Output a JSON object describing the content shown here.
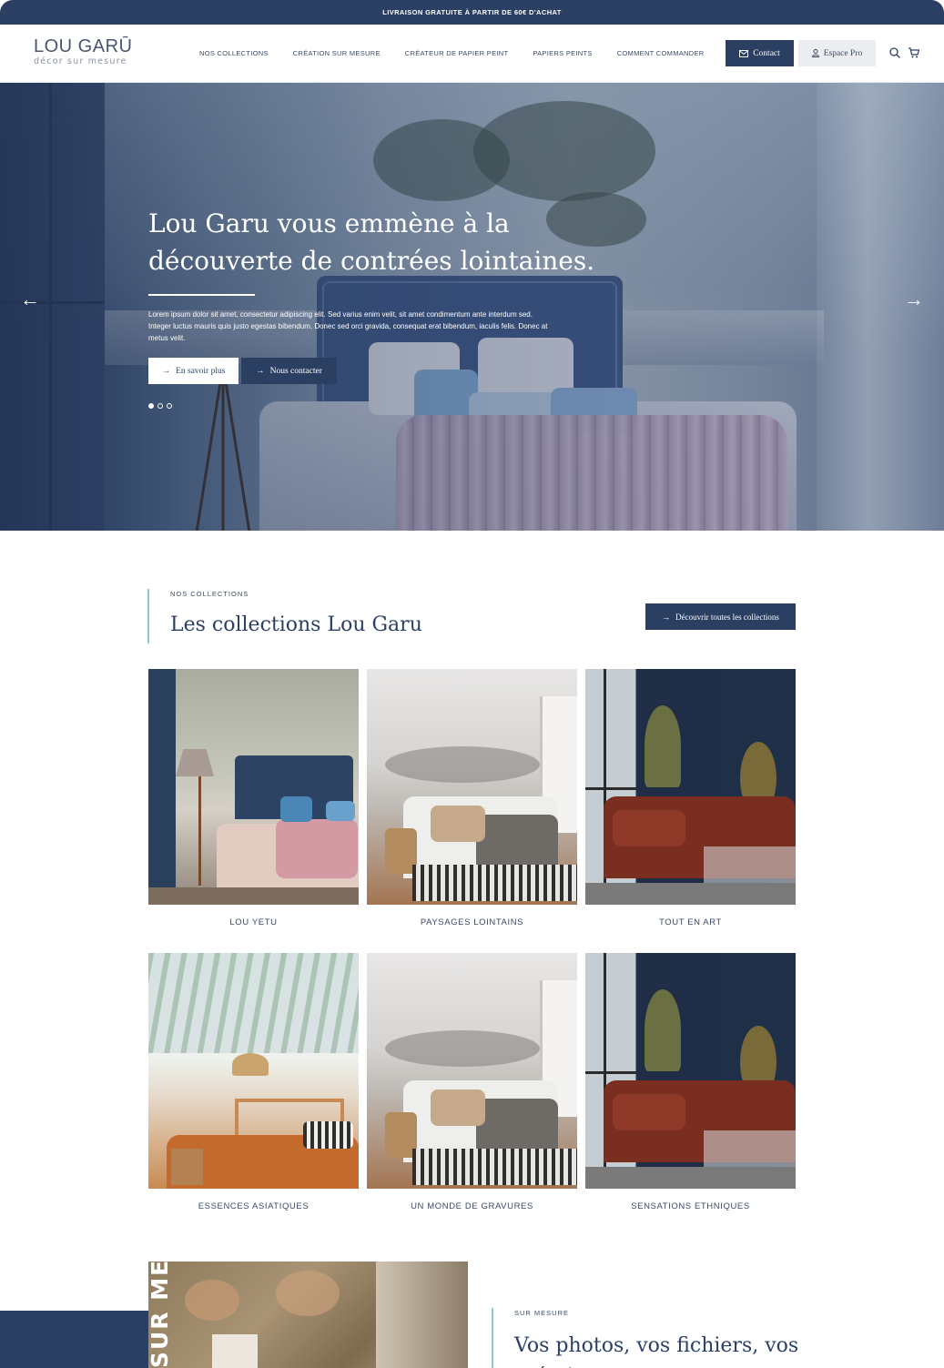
{
  "topbar": {
    "text": "LIVRAISON GRATUITE À PARTIR DE 60€ D'ACHAT"
  },
  "header": {
    "logo_name": "LOU GARŪ",
    "logo_sub": "décor sur mesure",
    "nav": [
      "NOS COLLECTIONS",
      "CRÉATION SUR MESURE",
      "CRÉATEUR DE PAPIER PEINT",
      "PAPIERS PEINTS",
      "COMMENT COMMANDER"
    ],
    "contact_label": "Contact",
    "pro_label": "Espace Pro",
    "icons": [
      "mail-icon",
      "user-icon",
      "search-icon",
      "cart-icon"
    ]
  },
  "hero": {
    "title": "Lou Garu vous emmène à la découverte de contrées lointaines.",
    "text": "Lorem ipsum dolor sit amet, consectetur adipiscing elit. Sed varius enim velit, sit amet condimentum ante interdum sed. Integer luctus mauris quis justo egestas bibendum. Donec sed orci gravida, consequat erat bibendum, iaculis felis. Donec at metus velit.",
    "btn_more": "En savoir plus",
    "btn_contact": "Nous contacter",
    "slides": 3,
    "active_slide": 1,
    "prev_arrow": "←",
    "next_arrow": "→"
  },
  "collections": {
    "kicker": "NOS COLLECTIONS",
    "title": "Les collections Lou Garu",
    "btn_all": "Découvrir toutes les collections",
    "items": [
      {
        "name": "LOU YETU"
      },
      {
        "name": "PAYSAGES LOINTAINS"
      },
      {
        "name": "TOUT EN ART"
      },
      {
        "name": "ESSENCES ASIATIQUES"
      },
      {
        "name": "UN MONDE DE GRAVURES"
      },
      {
        "name": "SENSATIONS ETHNIQUES"
      }
    ]
  },
  "sur_mesure": {
    "vertical_text": "SUR ME",
    "kicker": "SUR MESURE",
    "title": "Vos photos, vos fichiers, vos créations"
  },
  "colors": {
    "navy": "#2b3f63",
    "accent_teal": "#8fc6cf"
  }
}
